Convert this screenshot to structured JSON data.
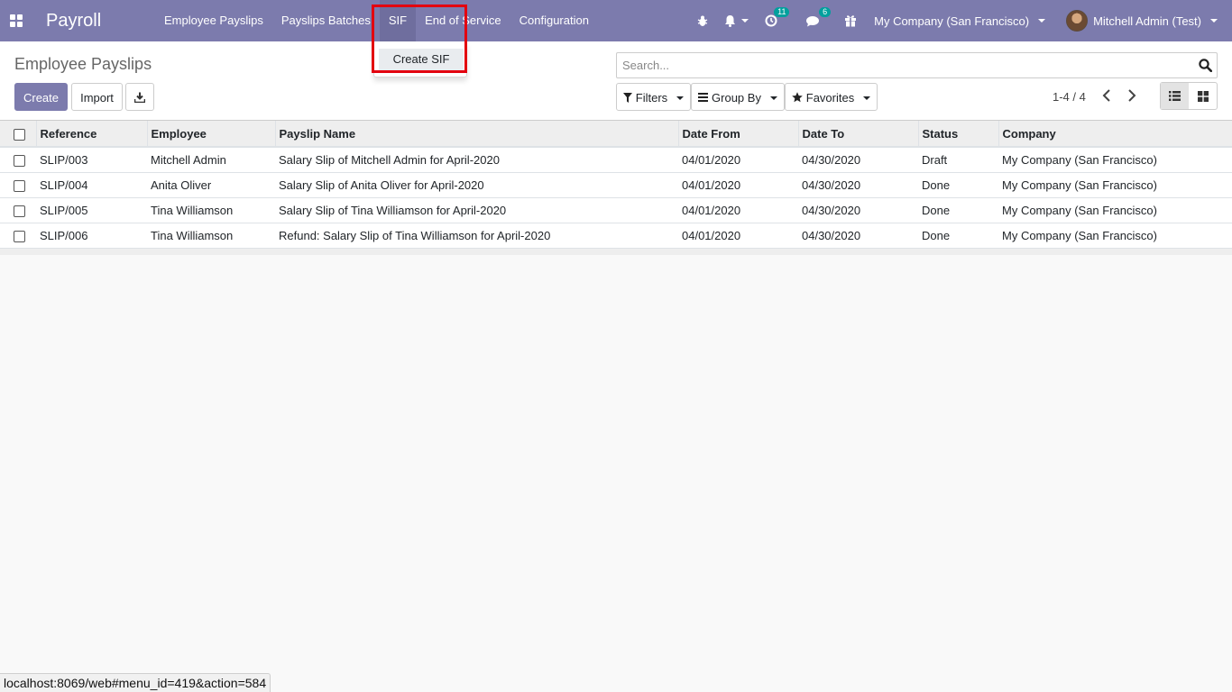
{
  "navbar": {
    "app_title": "Payroll",
    "menu": [
      "Employee Payslips",
      "Payslips Batches",
      "SIF",
      "End of Service",
      "Configuration"
    ],
    "active_menu": "SIF",
    "activity_count": "11",
    "messages_count": "6",
    "company": "My Company (San Francisco)",
    "user": "Mitchell Admin (Test)",
    "color": "#7c7bad"
  },
  "dropdown": {
    "item": "Create SIF"
  },
  "control": {
    "title": "Employee Payslips",
    "create_label": "Create",
    "import_label": "Import",
    "search_placeholder": "Search...",
    "filters_label": "Filters",
    "group_by_label": "Group By",
    "favorites_label": "Favorites",
    "pager": "1-4 / 4"
  },
  "table": {
    "columns": [
      "Reference",
      "Employee",
      "Payslip Name",
      "Date From",
      "Date To",
      "Status",
      "Company"
    ],
    "rows": [
      [
        "SLIP/003",
        "Mitchell Admin",
        "Salary Slip of Mitchell Admin for April-2020",
        "04/01/2020",
        "04/30/2020",
        "Draft",
        "My Company (San Francisco)"
      ],
      [
        "SLIP/004",
        "Anita Oliver",
        "Salary Slip of Anita Oliver for April-2020",
        "04/01/2020",
        "04/30/2020",
        "Done",
        "My Company (San Francisco)"
      ],
      [
        "SLIP/005",
        "Tina Williamson",
        "Salary Slip of Tina Williamson for April-2020",
        "04/01/2020",
        "04/30/2020",
        "Done",
        "My Company (San Francisco)"
      ],
      [
        "SLIP/006",
        "Tina Williamson",
        "Refund: Salary Slip of Tina Williamson for April-2020",
        "04/01/2020",
        "04/30/2020",
        "Done",
        "My Company (San Francisco)"
      ]
    ]
  },
  "statusbar": {
    "url": "localhost:8069/web#menu_id=419&action=584"
  }
}
